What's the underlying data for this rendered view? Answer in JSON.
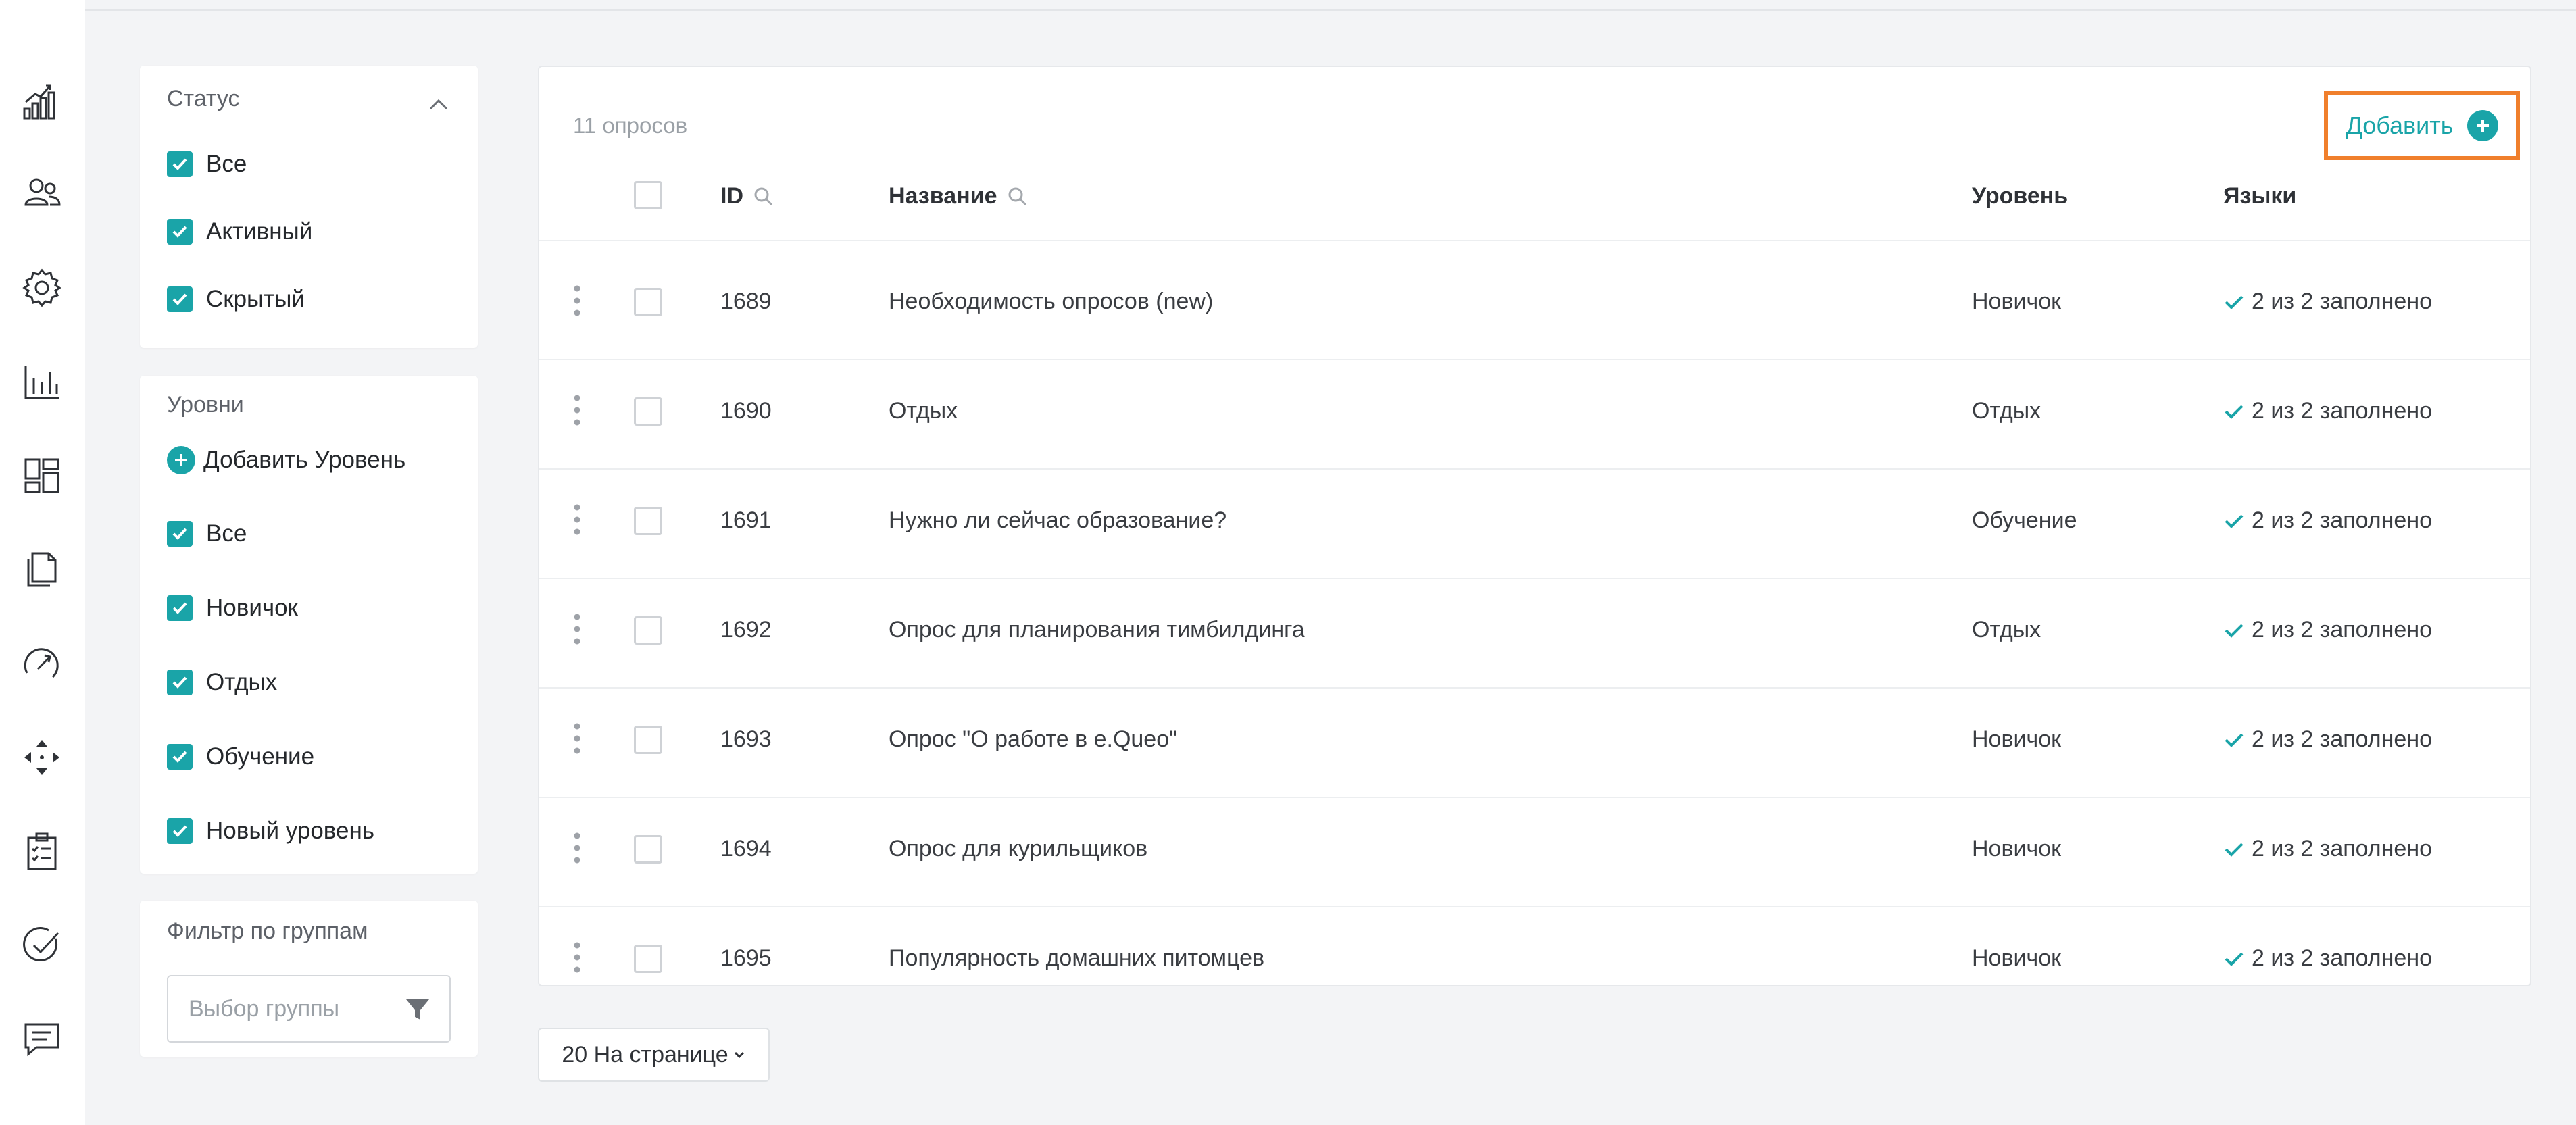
{
  "sidebar": {
    "icons": [
      "growth-chart-icon",
      "users-icon",
      "gear-icon",
      "bar-chart-icon",
      "dashboard-icon",
      "documents-icon",
      "speedometer-icon",
      "move-arrows-icon",
      "clipboard-checklist-icon",
      "check-circle-icon",
      "chat-icon"
    ]
  },
  "filters": {
    "status": {
      "title": "Статус",
      "items": [
        "Все",
        "Активный",
        "Скрытый"
      ]
    },
    "levels": {
      "title": "Уровни",
      "add_label": "Добавить Уровень",
      "items": [
        "Все",
        "Новичок",
        "Отдых",
        "Обучение",
        "Новый уровень"
      ]
    },
    "groups": {
      "title": "Фильтр по группам",
      "placeholder": "Выбор группы"
    }
  },
  "table": {
    "count_label": "11 опросов",
    "add_button_label": "Добавить",
    "columns": {
      "id": "ID",
      "name": "Название",
      "level": "Уровень",
      "languages": "Языки"
    },
    "rows": [
      {
        "id": "1689",
        "name": "Необходимость опросов (new)",
        "level": "Новичок",
        "languages": "2 из 2 заполнено"
      },
      {
        "id": "1690",
        "name": "Отдых",
        "level": "Отдых",
        "languages": "2 из 2 заполнено"
      },
      {
        "id": "1691",
        "name": "Нужно ли сейчас образование?",
        "level": "Обучение",
        "languages": "2 из 2 заполнено"
      },
      {
        "id": "1692",
        "name": "Опрос для планирования тимбилдинга",
        "level": "Отдых",
        "languages": "2 из 2 заполнено"
      },
      {
        "id": "1693",
        "name": "Опрос \"О работе в e.Queo\"",
        "level": "Новичок",
        "languages": "2 из 2 заполнено"
      },
      {
        "id": "1694",
        "name": "Опрос для курильщиков",
        "level": "Новичок",
        "languages": "2 из 2 заполнено"
      },
      {
        "id": "1695",
        "name": "Популярность домашних питомцев",
        "level": "Новичок",
        "languages": "2 из 2 заполнено"
      }
    ]
  },
  "pagination": {
    "per_page_label": "20 На странице"
  },
  "colors": {
    "accent": "#1aa4a8",
    "highlight": "#f07f2c",
    "background": "#f3f4f6"
  }
}
